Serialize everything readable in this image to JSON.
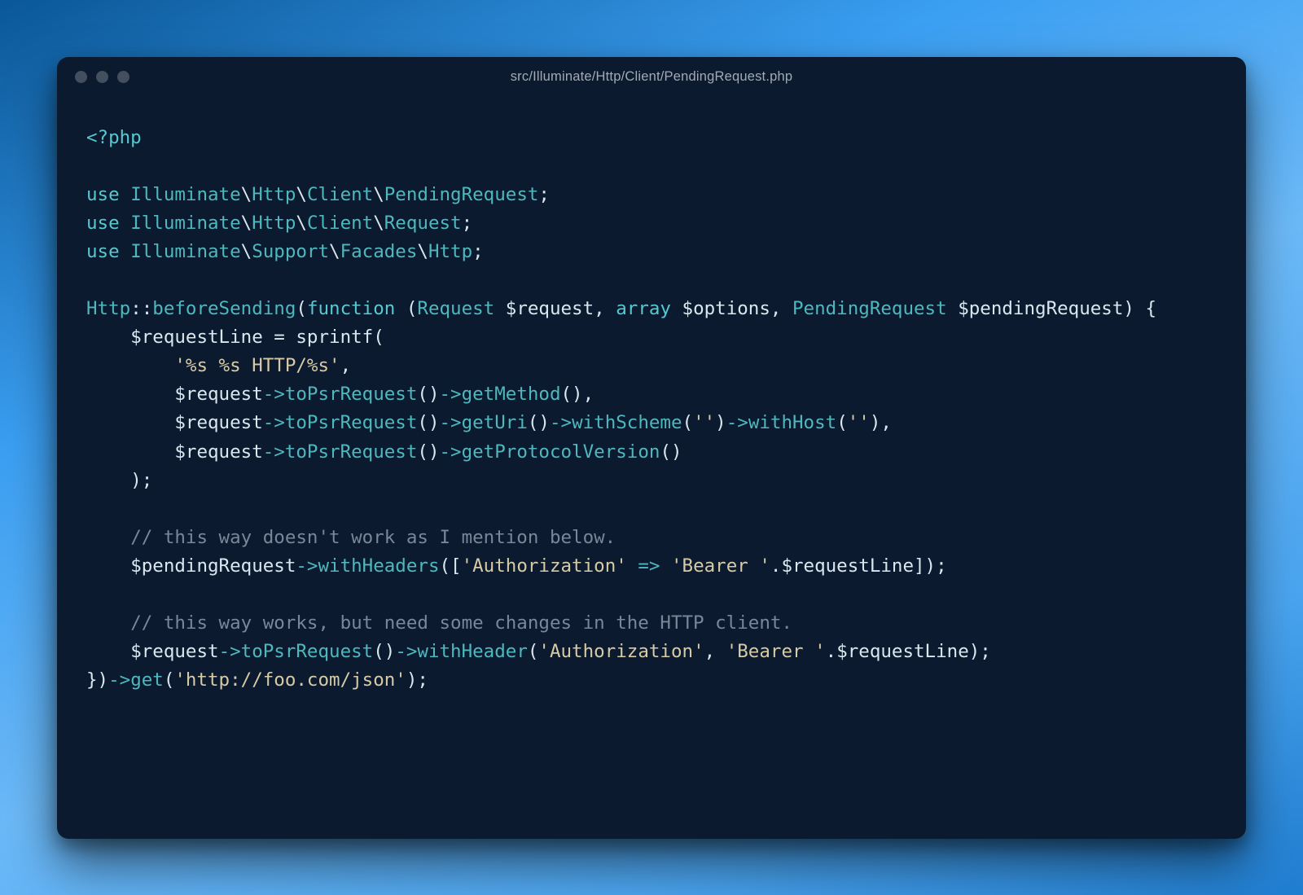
{
  "window": {
    "title": "src/Illuminate/Http/Client/PendingRequest.php"
  },
  "code": {
    "tokens": [
      {
        "t": "<?php",
        "c": "tk-kw"
      },
      {
        "t": "\n\n",
        "c": "tk-plain"
      },
      {
        "t": "use",
        "c": "tk-kw"
      },
      {
        "t": " ",
        "c": "tk-plain"
      },
      {
        "t": "Illuminate",
        "c": "tk-ns"
      },
      {
        "t": "\\",
        "c": "tk-plain"
      },
      {
        "t": "Http",
        "c": "tk-ns"
      },
      {
        "t": "\\",
        "c": "tk-plain"
      },
      {
        "t": "Client",
        "c": "tk-ns"
      },
      {
        "t": "\\",
        "c": "tk-plain"
      },
      {
        "t": "PendingRequest",
        "c": "tk-ns"
      },
      {
        "t": ";",
        "c": "tk-plain"
      },
      {
        "t": "\n",
        "c": "tk-plain"
      },
      {
        "t": "use",
        "c": "tk-kw"
      },
      {
        "t": " ",
        "c": "tk-plain"
      },
      {
        "t": "Illuminate",
        "c": "tk-ns"
      },
      {
        "t": "\\",
        "c": "tk-plain"
      },
      {
        "t": "Http",
        "c": "tk-ns"
      },
      {
        "t": "\\",
        "c": "tk-plain"
      },
      {
        "t": "Client",
        "c": "tk-ns"
      },
      {
        "t": "\\",
        "c": "tk-plain"
      },
      {
        "t": "Request",
        "c": "tk-ns"
      },
      {
        "t": ";",
        "c": "tk-plain"
      },
      {
        "t": "\n",
        "c": "tk-plain"
      },
      {
        "t": "use",
        "c": "tk-kw"
      },
      {
        "t": " ",
        "c": "tk-plain"
      },
      {
        "t": "Illuminate",
        "c": "tk-ns"
      },
      {
        "t": "\\",
        "c": "tk-plain"
      },
      {
        "t": "Support",
        "c": "tk-ns"
      },
      {
        "t": "\\",
        "c": "tk-plain"
      },
      {
        "t": "Facades",
        "c": "tk-ns"
      },
      {
        "t": "\\",
        "c": "tk-plain"
      },
      {
        "t": "Http",
        "c": "tk-ns"
      },
      {
        "t": ";",
        "c": "tk-plain"
      },
      {
        "t": "\n\n",
        "c": "tk-plain"
      },
      {
        "t": "Http",
        "c": "tk-type"
      },
      {
        "t": "::",
        "c": "tk-plain"
      },
      {
        "t": "beforeSending",
        "c": "tk-func"
      },
      {
        "t": "(",
        "c": "tk-punc"
      },
      {
        "t": "function",
        "c": "tk-kw"
      },
      {
        "t": " (",
        "c": "tk-plain"
      },
      {
        "t": "Request",
        "c": "tk-type"
      },
      {
        "t": " ",
        "c": "tk-plain"
      },
      {
        "t": "$request",
        "c": "tk-var"
      },
      {
        "t": ", ",
        "c": "tk-plain"
      },
      {
        "t": "array",
        "c": "tk-kw"
      },
      {
        "t": " ",
        "c": "tk-plain"
      },
      {
        "t": "$options",
        "c": "tk-var"
      },
      {
        "t": ", ",
        "c": "tk-plain"
      },
      {
        "t": "PendingRequest",
        "c": "tk-type"
      },
      {
        "t": " ",
        "c": "tk-plain"
      },
      {
        "t": "$pendingRequest",
        "c": "tk-var"
      },
      {
        "t": ") {",
        "c": "tk-plain"
      },
      {
        "t": "\n",
        "c": "tk-plain"
      },
      {
        "t": "    ",
        "c": "tk-plain"
      },
      {
        "t": "$requestLine",
        "c": "tk-var"
      },
      {
        "t": " = ",
        "c": "tk-plain"
      },
      {
        "t": "sprintf",
        "c": "tk-plain"
      },
      {
        "t": "(",
        "c": "tk-punc"
      },
      {
        "t": "\n",
        "c": "tk-plain"
      },
      {
        "t": "        ",
        "c": "tk-plain"
      },
      {
        "t": "'%s %s HTTP/%s'",
        "c": "tk-str"
      },
      {
        "t": ",",
        "c": "tk-plain"
      },
      {
        "t": "\n",
        "c": "tk-plain"
      },
      {
        "t": "        ",
        "c": "tk-plain"
      },
      {
        "t": "$request",
        "c": "tk-var"
      },
      {
        "t": "->",
        "c": "tk-op"
      },
      {
        "t": "toPsrRequest",
        "c": "tk-func"
      },
      {
        "t": "()",
        "c": "tk-plain"
      },
      {
        "t": "->",
        "c": "tk-op"
      },
      {
        "t": "getMethod",
        "c": "tk-func"
      },
      {
        "t": "(),",
        "c": "tk-plain"
      },
      {
        "t": "\n",
        "c": "tk-plain"
      },
      {
        "t": "        ",
        "c": "tk-plain"
      },
      {
        "t": "$request",
        "c": "tk-var"
      },
      {
        "t": "->",
        "c": "tk-op"
      },
      {
        "t": "toPsrRequest",
        "c": "tk-func"
      },
      {
        "t": "()",
        "c": "tk-plain"
      },
      {
        "t": "->",
        "c": "tk-op"
      },
      {
        "t": "getUri",
        "c": "tk-func"
      },
      {
        "t": "()",
        "c": "tk-plain"
      },
      {
        "t": "->",
        "c": "tk-op"
      },
      {
        "t": "withScheme",
        "c": "tk-func"
      },
      {
        "t": "(",
        "c": "tk-plain"
      },
      {
        "t": "''",
        "c": "tk-str"
      },
      {
        "t": ")",
        "c": "tk-plain"
      },
      {
        "t": "->",
        "c": "tk-op"
      },
      {
        "t": "withHost",
        "c": "tk-func"
      },
      {
        "t": "(",
        "c": "tk-plain"
      },
      {
        "t": "''",
        "c": "tk-str"
      },
      {
        "t": "),",
        "c": "tk-plain"
      },
      {
        "t": "\n",
        "c": "tk-plain"
      },
      {
        "t": "        ",
        "c": "tk-plain"
      },
      {
        "t": "$request",
        "c": "tk-var"
      },
      {
        "t": "->",
        "c": "tk-op"
      },
      {
        "t": "toPsrRequest",
        "c": "tk-func"
      },
      {
        "t": "()",
        "c": "tk-plain"
      },
      {
        "t": "->",
        "c": "tk-op"
      },
      {
        "t": "getProtocolVersion",
        "c": "tk-func"
      },
      {
        "t": "()",
        "c": "tk-plain"
      },
      {
        "t": "\n",
        "c": "tk-plain"
      },
      {
        "t": "    );",
        "c": "tk-plain"
      },
      {
        "t": "\n\n",
        "c": "tk-plain"
      },
      {
        "t": "    ",
        "c": "tk-plain"
      },
      {
        "t": "// this way doesn't work as I mention below.",
        "c": "tk-cmt"
      },
      {
        "t": "\n",
        "c": "tk-plain"
      },
      {
        "t": "    ",
        "c": "tk-plain"
      },
      {
        "t": "$pendingRequest",
        "c": "tk-var"
      },
      {
        "t": "->",
        "c": "tk-op"
      },
      {
        "t": "withHeaders",
        "c": "tk-func"
      },
      {
        "t": "([",
        "c": "tk-plain"
      },
      {
        "t": "'Authorization'",
        "c": "tk-str"
      },
      {
        "t": " ",
        "c": "tk-plain"
      },
      {
        "t": "=>",
        "c": "tk-op"
      },
      {
        "t": " ",
        "c": "tk-plain"
      },
      {
        "t": "'Bearer '",
        "c": "tk-str"
      },
      {
        "t": ".",
        "c": "tk-plain"
      },
      {
        "t": "$requestLine",
        "c": "tk-var"
      },
      {
        "t": "]);",
        "c": "tk-plain"
      },
      {
        "t": "\n\n",
        "c": "tk-plain"
      },
      {
        "t": "    ",
        "c": "tk-plain"
      },
      {
        "t": "// this way works, but need some changes in the HTTP client.",
        "c": "tk-cmt"
      },
      {
        "t": "\n",
        "c": "tk-plain"
      },
      {
        "t": "    ",
        "c": "tk-plain"
      },
      {
        "t": "$request",
        "c": "tk-var"
      },
      {
        "t": "->",
        "c": "tk-op"
      },
      {
        "t": "toPsrRequest",
        "c": "tk-func"
      },
      {
        "t": "()",
        "c": "tk-plain"
      },
      {
        "t": "->",
        "c": "tk-op"
      },
      {
        "t": "withHeader",
        "c": "tk-func"
      },
      {
        "t": "(",
        "c": "tk-plain"
      },
      {
        "t": "'Authorization'",
        "c": "tk-str"
      },
      {
        "t": ", ",
        "c": "tk-plain"
      },
      {
        "t": "'Bearer '",
        "c": "tk-str"
      },
      {
        "t": ".",
        "c": "tk-plain"
      },
      {
        "t": "$requestLine",
        "c": "tk-var"
      },
      {
        "t": ");",
        "c": "tk-plain"
      },
      {
        "t": "\n",
        "c": "tk-plain"
      },
      {
        "t": "})",
        "c": "tk-plain"
      },
      {
        "t": "->",
        "c": "tk-op"
      },
      {
        "t": "get",
        "c": "tk-func"
      },
      {
        "t": "(",
        "c": "tk-plain"
      },
      {
        "t": "'http://foo.com/json'",
        "c": "tk-str"
      },
      {
        "t": ");",
        "c": "tk-plain"
      }
    ]
  }
}
